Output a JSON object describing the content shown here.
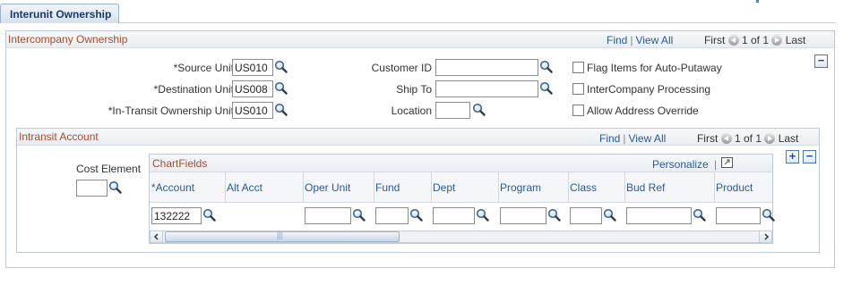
{
  "tab": {
    "label": "Interunit Ownership"
  },
  "main": {
    "title": "Intercompany Ownership",
    "nav": {
      "find": "Find",
      "view_all": "View All",
      "first": "First",
      "count": "1 of 1",
      "last": "Last"
    },
    "collapse": "−",
    "source_unit": {
      "label": "*Source Unit",
      "value": "US010"
    },
    "destination_unit": {
      "label": "*Destination Unit",
      "value": "US008"
    },
    "intransit_unit": {
      "label": "*In-Transit Ownership Unit",
      "value": "US010"
    },
    "customer_id": {
      "label": "Customer ID",
      "value": ""
    },
    "ship_to": {
      "label": "Ship To",
      "value": ""
    },
    "location": {
      "label": "Location",
      "value": ""
    },
    "flag_items": {
      "label": "Flag Items for Auto-Putaway",
      "checked": false
    },
    "intercompany_processing": {
      "label": "InterCompany Processing",
      "checked": false
    },
    "allow_address_override": {
      "label": "Allow Address Override",
      "checked": false
    }
  },
  "intransit": {
    "title": "Intransit Account",
    "nav": {
      "find": "Find",
      "view_all": "View All",
      "first": "First",
      "count": "1 of 1",
      "last": "Last"
    },
    "add": "+",
    "remove": "−",
    "cost_element": {
      "label": "Cost Element",
      "value": ""
    },
    "grid": {
      "title": "ChartFields",
      "personalize": "Personalize",
      "columns": [
        "*Account",
        "Alt Acct",
        "Oper Unit",
        "Fund",
        "Dept",
        "Program",
        "Class",
        "Bud Ref",
        "Product"
      ],
      "row": {
        "account": "132222",
        "alt_acct": "",
        "oper_unit": "",
        "fund": "",
        "dept": "",
        "program": "",
        "class": "",
        "bud_ref": "",
        "product": ""
      },
      "scroll_mark": "|||"
    }
  },
  "colors": {
    "accent_title": "#a84b2b",
    "link": "#2a5b97",
    "border": "#c0c9d3"
  },
  "icons": {
    "lookup": "magnifier-icon",
    "nav_prev": "arrow-left-icon",
    "nav_next": "arrow-right-icon",
    "expand": "expand-grid-icon"
  }
}
